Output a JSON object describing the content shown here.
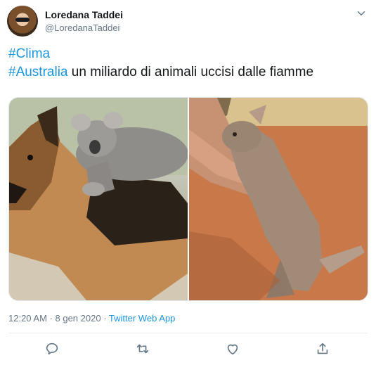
{
  "author": {
    "name": "Loredana Taddei",
    "handle": "@LoredanaTaddei"
  },
  "tweet": {
    "hashtag1": "#Clima",
    "hashtag2": "#Australia",
    "text": " un miliardo di animali uccisi dalle fiamme"
  },
  "media": {
    "left_description": "German shepherd dog carrying a koala on its back",
    "right_description": "Person holding a baby kangaroo on red sand"
  },
  "meta": {
    "time": "12:20 AM",
    "date": "8 gen 2020",
    "separator": " · ",
    "source": "Twitter Web App"
  },
  "colors": {
    "accent": "#1b95e0",
    "text": "#14171a",
    "muted": "#657786"
  },
  "icons": {
    "caret": "chevron-down-icon",
    "reply": "reply-icon",
    "retweet": "retweet-icon",
    "like": "like-icon",
    "share": "share-icon"
  }
}
